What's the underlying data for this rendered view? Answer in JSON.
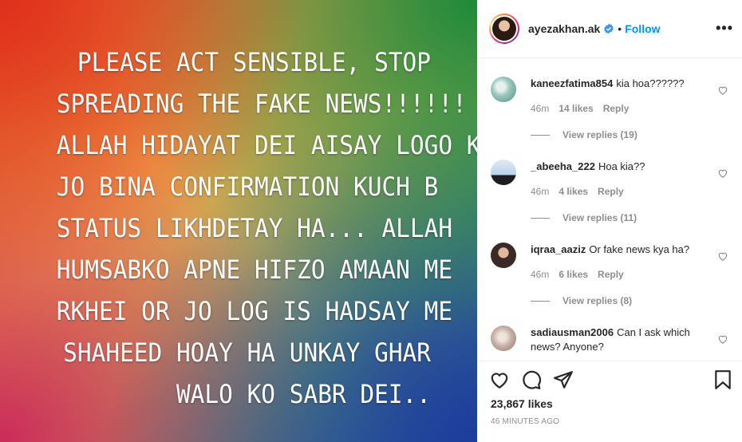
{
  "post": {
    "text_lines": [
      "PLEASE ACT SENSIBLE, STOP",
      "SPREADING THE FAKE NEWS!!!!!!",
      "ALLAH HIDAYAT DEI AISAY LOGO KO",
      "JO BINA CONFIRMATION KUCH B",
      "STATUS LIKHDETAY HA... ALLAH",
      "HUMSABKO APNE HIFZO AMAAN ME",
      "RKHEI OR JO LOG IS HADSAY ME",
      "SHAHEED HOAY HA UNKAY GHAR",
      "WALO KO SABR DEI.."
    ]
  },
  "header": {
    "username": "ayezakhan.ak",
    "separator": "•",
    "follow_label": "Follow",
    "more_label": "•••",
    "verified": true
  },
  "comments": [
    {
      "user": "kaneezfatima854",
      "text": "kia hoa??????",
      "time": "46m",
      "likes": "14 likes",
      "reply": "Reply",
      "view_replies": "View replies (19)",
      "avatar_color": "#9fc8c0"
    },
    {
      "user": "_abeeha_222",
      "text": "Hoa kia??",
      "time": "46m",
      "likes": "4 likes",
      "reply": "Reply",
      "view_replies": "View replies (11)",
      "avatar_color": "#b9d4ea"
    },
    {
      "user": "iqraa_aaziz",
      "text": "Or fake news kya ha?",
      "time": "46m",
      "likes": "6 likes",
      "reply": "Reply",
      "view_replies": "View replies (8)",
      "avatar_color": "#3a2a26"
    },
    {
      "user": "sadiausman2006",
      "text": "Can I ask which news? Anyone?",
      "avatar_color": "#c9b3a8"
    }
  ],
  "footer": {
    "likes": "23,867 likes",
    "time": "46 MINUTES AGO"
  },
  "colors": {
    "accent": "#0095f6",
    "muted": "#8e8e8e",
    "text": "#262626"
  }
}
